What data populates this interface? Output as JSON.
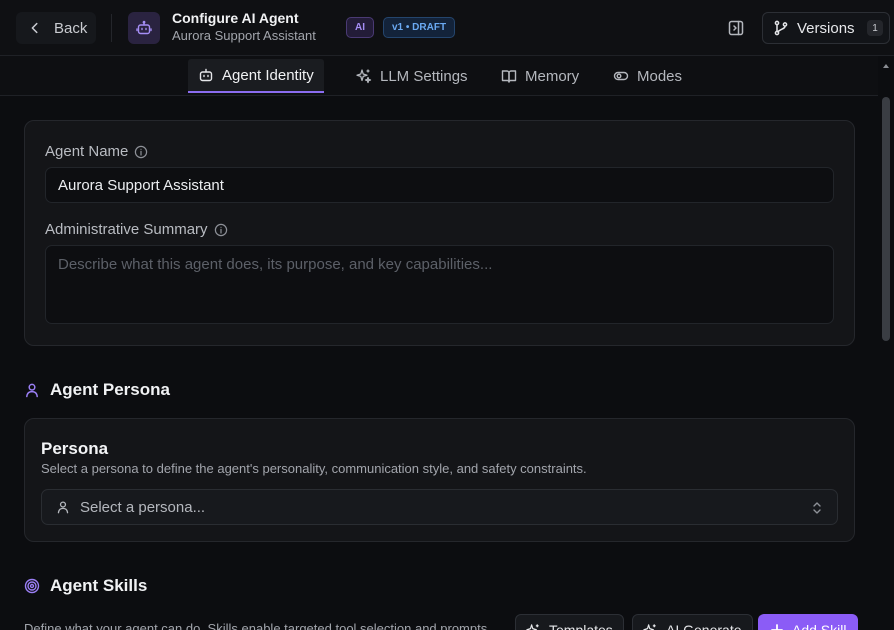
{
  "header": {
    "back_label": "Back",
    "title": "Configure AI Agent",
    "subtitle": "Aurora Support Assistant",
    "badge_ai": "AI",
    "badge_version": "v1 • DRAFT",
    "versions_label": "Versions",
    "versions_count": "1",
    "icons": {
      "back": "chevron-left-icon",
      "bot": "bot-icon",
      "panel": "panel-toggle-icon",
      "versions": "git-branch-icon"
    }
  },
  "tabs": [
    {
      "label": "Agent Identity",
      "icon": "bot-icon",
      "active": true
    },
    {
      "label": "LLM Settings",
      "icon": "sparkles-icon",
      "active": false
    },
    {
      "label": "Memory",
      "icon": "book-open-icon",
      "active": false
    },
    {
      "label": "Modes",
      "icon": "toggle-icon",
      "active": false
    }
  ],
  "identity": {
    "name_label": "Agent Name",
    "name_value": "Aurora Support Assistant",
    "summary_label": "Administrative Summary",
    "summary_placeholder": "Describe what this agent does, its purpose, and key capabilities..."
  },
  "persona": {
    "section_title": "Agent Persona",
    "card_title": "Persona",
    "card_description": "Select a persona to define the agent's personality, communication style, and safety constraints.",
    "select_placeholder": "Select a persona..."
  },
  "skills": {
    "section_title": "Agent Skills",
    "description": "Define what your agent can do. Skills enable targeted tool selection and prompts",
    "templates_label": "Templates",
    "ai_generate_label": "AI Generate",
    "add_skill_label": "Add Skill"
  },
  "colors": {
    "accent": "#8b5cf6",
    "badge_ai": "#a58ef5",
    "badge_version": "#6aa9f2",
    "background": "#0c0d10"
  }
}
